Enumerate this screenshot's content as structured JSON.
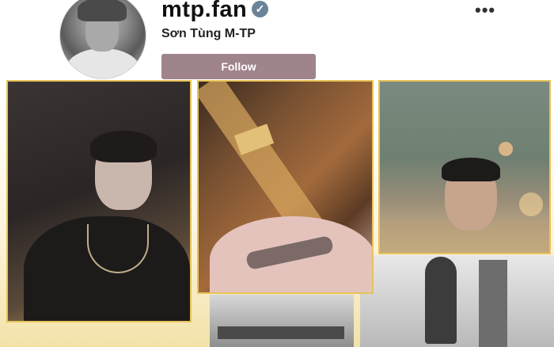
{
  "profile": {
    "username": "mtp.fan",
    "display_name": "Sơn Tùng M-TP",
    "follow_label": "Follow",
    "more_label": "•••",
    "verified_glyph": "✓"
  },
  "colors": {
    "follow_button": "#a0848c",
    "verified_badge": "#6b8398",
    "photo_border": "#e8c35a"
  },
  "icons": {
    "verified": "verified-check-icon",
    "more": "more-horizontal-icon"
  }
}
